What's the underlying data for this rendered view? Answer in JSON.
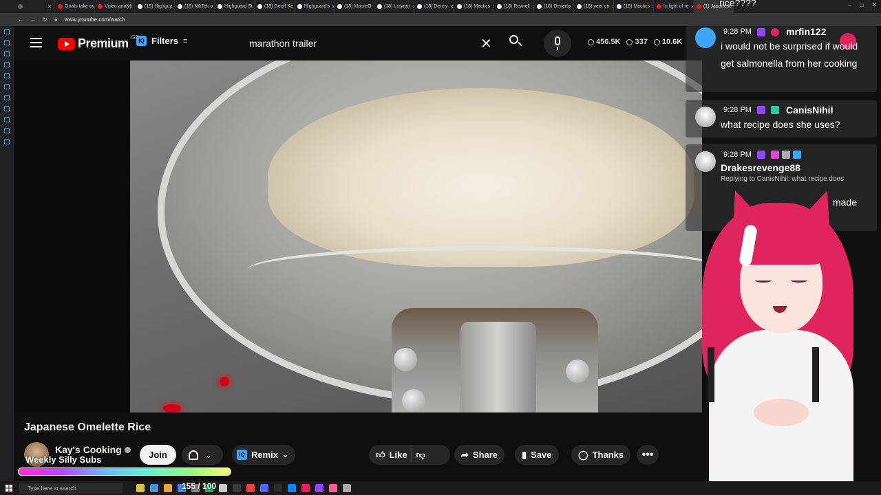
{
  "browser": {
    "tabs": [
      {
        "label": "",
        "color": "#5f6368"
      },
      {
        "label": "Goats take ov",
        "color": "#e62117"
      },
      {
        "label": "Video analyti",
        "color": "#e62117"
      },
      {
        "label": "(18) Highgua",
        "color": "#ffffff"
      },
      {
        "label": "(18) NikTek o",
        "color": "#ffffff"
      },
      {
        "label": "Highguard St",
        "color": "#ffffff"
      },
      {
        "label": "(18) Geoff Ke",
        "color": "#ffffff"
      },
      {
        "label": "Highguard's",
        "color": "#ffffff"
      },
      {
        "label": "(18) MooreO",
        "color": "#ffffff"
      },
      {
        "label": "(18) Lutyran",
        "color": "#ffffff"
      },
      {
        "label": "(18) Denny",
        "color": "#ffffff"
      },
      {
        "label": "(18) Mactics",
        "color": "#ffffff"
      },
      {
        "label": "(18) Rewrell",
        "color": "#ffffff"
      },
      {
        "label": "(18) Dexerto",
        "color": "#ffffff"
      },
      {
        "label": "(18) yeet on",
        "color": "#ffffff"
      },
      {
        "label": "(18) Mactics",
        "color": "#ffffff"
      },
      {
        "label": "In light of re",
        "color": "#e62117"
      },
      {
        "label": "(1) Japanese",
        "color": "#e62117"
      }
    ],
    "url": "www.youtube.com/watch"
  },
  "youtube": {
    "logo_text": "Premium",
    "country_code": "GB",
    "filters_label": "Filters",
    "iq_badge": "IQ",
    "search_query": "marathon trailer",
    "stats": [
      "456.5K",
      "337",
      "10.6K"
    ]
  },
  "video": {
    "title": "Japanese Omelette Rice",
    "channel": "Kay's Cooking",
    "subscribers": "",
    "join_label": "Join",
    "remix_label": "Remix",
    "like_label": "Like",
    "share_label": "Share",
    "save_label": "Save",
    "thanks_label": "Thanks",
    "more_label": "•••"
  },
  "overlay": {
    "sub_goal_label": "Weekly Silly Subs",
    "sub_count": "155 / 100",
    "top_chat_fragment": "rice????"
  },
  "chat": [
    {
      "time": "9:28 PM",
      "user": "mrfin122",
      "text": "i would not be surprised if would get salmonella from her cooking",
      "badge_color": "#9146ff"
    },
    {
      "time": "9:28 PM",
      "user": "CanisNihil",
      "text": "what recipe does she uses?",
      "badge_color": "#9146ff"
    },
    {
      "time": "9:28 PM",
      "user": "Drakesrevenge88",
      "reply": "Replying to CanisNihil: what recipe does",
      "text": "made",
      "badge_color": "#9146ff"
    }
  ],
  "taskbar": {
    "search_placeholder": "Type here to search"
  }
}
